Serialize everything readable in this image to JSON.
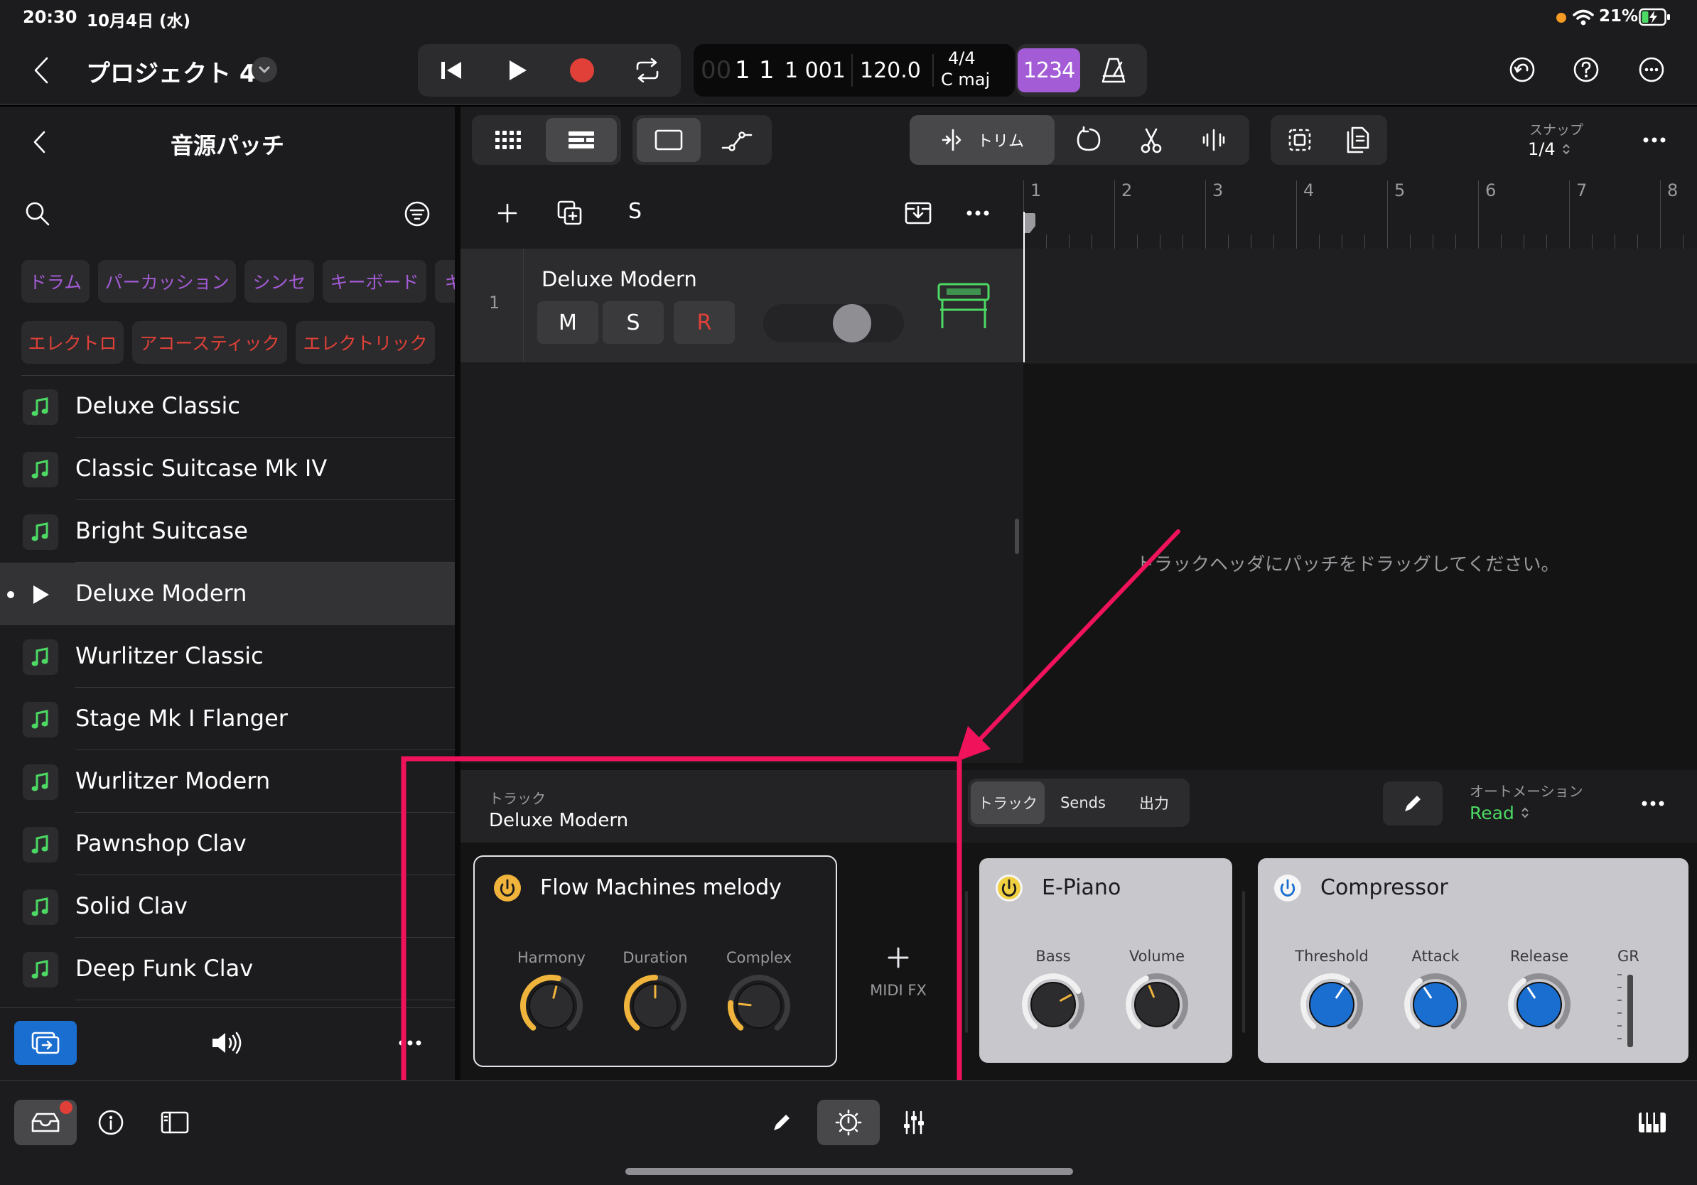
{
  "status_bar": {
    "time": "20:30",
    "date": "10月4日 (水)",
    "battery": "21%"
  },
  "header": {
    "project_title": "プロジェクト 4",
    "lcd": {
      "position_dim": "00",
      "position_bar": "1",
      "position_beat": "1",
      "position_tick": "1 001",
      "tempo": "120.0",
      "time_sig": "4/4",
      "key": "C maj"
    },
    "count_in": "1234"
  },
  "library": {
    "title": "音源パッチ",
    "categories_row1": [
      "ドラム",
      "パーカッション",
      "シンセ",
      "キーボード",
      "ギ"
    ],
    "categories_row2": [
      "エレクトロ",
      "アコースティック",
      "エレクトリック"
    ],
    "patches": [
      {
        "name": "Deluxe Classic",
        "selected": false
      },
      {
        "name": "Classic Suitcase Mk IV",
        "selected": false
      },
      {
        "name": "Bright Suitcase",
        "selected": false
      },
      {
        "name": "Deluxe Modern",
        "selected": true
      },
      {
        "name": "Wurlitzer Classic",
        "selected": false
      },
      {
        "name": "Stage Mk I Flanger",
        "selected": false
      },
      {
        "name": "Wurlitzer Modern",
        "selected": false
      },
      {
        "name": "Pawnshop Clav",
        "selected": false
      },
      {
        "name": "Solid Clav",
        "selected": false
      },
      {
        "name": "Deep Funk Clav",
        "selected": false
      }
    ]
  },
  "toolbar": {
    "trim_label": "トリム",
    "snap_label": "スナップ",
    "snap_value": "1/4"
  },
  "tracks": {
    "header_s": "S",
    "track": {
      "number": "1",
      "name": "Deluxe Modern",
      "mute": "M",
      "solo": "S",
      "record": "R",
      "volume": 0.75
    }
  },
  "ruler": {
    "bars": [
      "1",
      "2",
      "3",
      "4",
      "5",
      "6",
      "7",
      "8"
    ]
  },
  "timeline_hint": "トラックヘッダにパッチをドラッグしてください。",
  "inspector": {
    "section_label": "トラック",
    "track_name": "Deluxe Modern",
    "tabs": [
      "トラック",
      "Sends",
      "出力"
    ],
    "automation_label": "オートメーション",
    "automation_value": "Read",
    "midi_fx_label": "MIDI FX"
  },
  "plugins": {
    "flow": {
      "title": "Flow Machines melody",
      "knobs": [
        {
          "label": "Harmony",
          "value": 0.55
        },
        {
          "label": "Duration",
          "value": 0.5
        },
        {
          "label": "Complex",
          "value": 0.2
        }
      ]
    },
    "epiano": {
      "title": "E-Piano",
      "knobs": [
        {
          "label": "Bass",
          "value": 0.72
        },
        {
          "label": "Volume",
          "value": 0.42
        }
      ]
    },
    "compressor": {
      "title": "Compressor",
      "knobs": [
        {
          "label": "Threshold",
          "value": 0.62
        },
        {
          "label": "Attack",
          "value": 0.38
        },
        {
          "label": "Release",
          "value": 0.38
        }
      ],
      "meter_label": "GR"
    }
  },
  "colors": {
    "accent_purple": "#a45bd6",
    "record_red": "#e04038",
    "patch_green": "#4cd964",
    "annotation_pink": "#f0135c",
    "power_yellow": "#f0b43c",
    "knob_blue": "#1a6ecf"
  }
}
